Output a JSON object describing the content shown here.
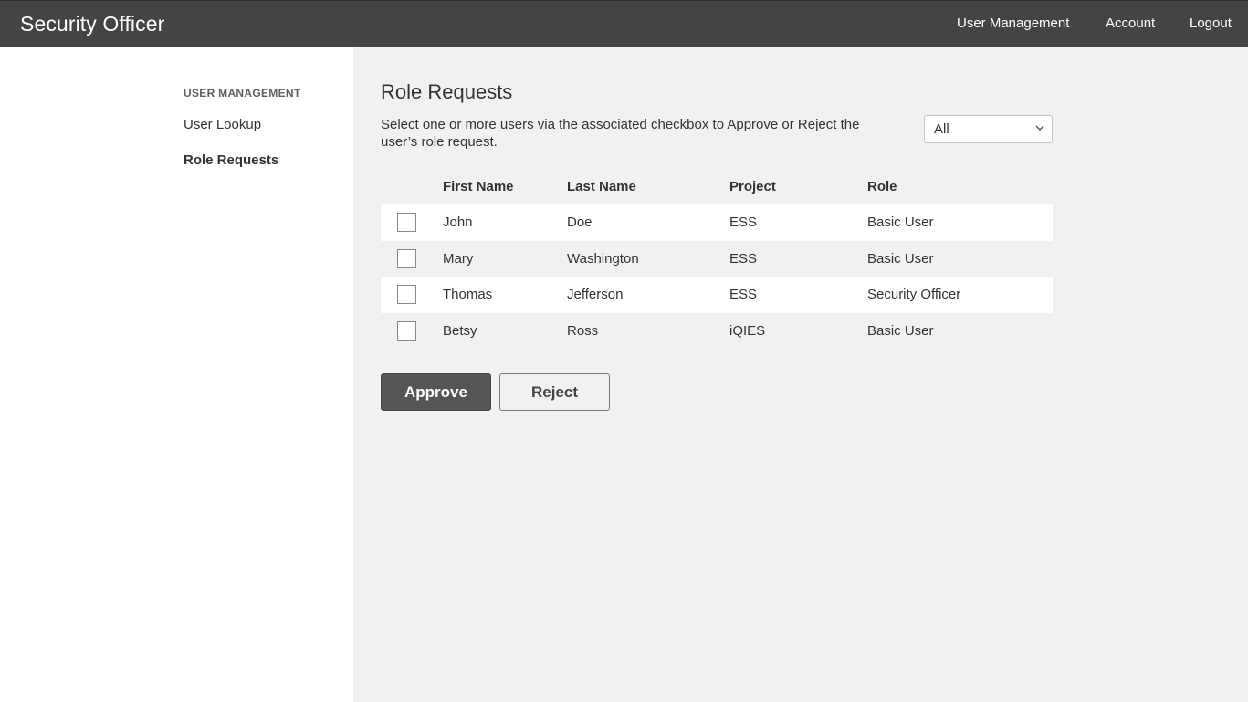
{
  "header": {
    "title": "Security Officer",
    "nav": [
      "User Management",
      "Account",
      "Logout"
    ]
  },
  "sidebar": {
    "heading": "USER MANAGEMENT",
    "items": [
      {
        "label": "User Lookup",
        "active": false
      },
      {
        "label": "Role Requests",
        "active": true
      }
    ]
  },
  "main": {
    "title": "Role Requests",
    "instructions": "Select one or more users via the associated checkbox to Approve or Reject the user’s role request.",
    "filter": {
      "selected": "All"
    },
    "table": {
      "columns": [
        "First Name",
        "Last Name",
        "Project",
        "Role"
      ],
      "rows": [
        {
          "first": "John",
          "last": "Doe",
          "project": "ESS",
          "role": "Basic User",
          "checked": false
        },
        {
          "first": "Mary",
          "last": "Washington",
          "project": "ESS",
          "role": "Basic User",
          "checked": false
        },
        {
          "first": "Thomas",
          "last": "Jefferson",
          "project": "ESS",
          "role": "Security Officer",
          "checked": false
        },
        {
          "first": "Betsy",
          "last": "Ross",
          "project": "iQIES",
          "role": "Basic User",
          "checked": false
        }
      ]
    },
    "actions": {
      "approve": "Approve",
      "reject": "Reject"
    }
  },
  "colors": {
    "topbar": "#444446",
    "main_bg": "#f0f1f0",
    "primary_button": "#555557"
  },
  "icons": {
    "dropdown": "chevron-down-icon",
    "checkbox": "checkbox-icon"
  }
}
